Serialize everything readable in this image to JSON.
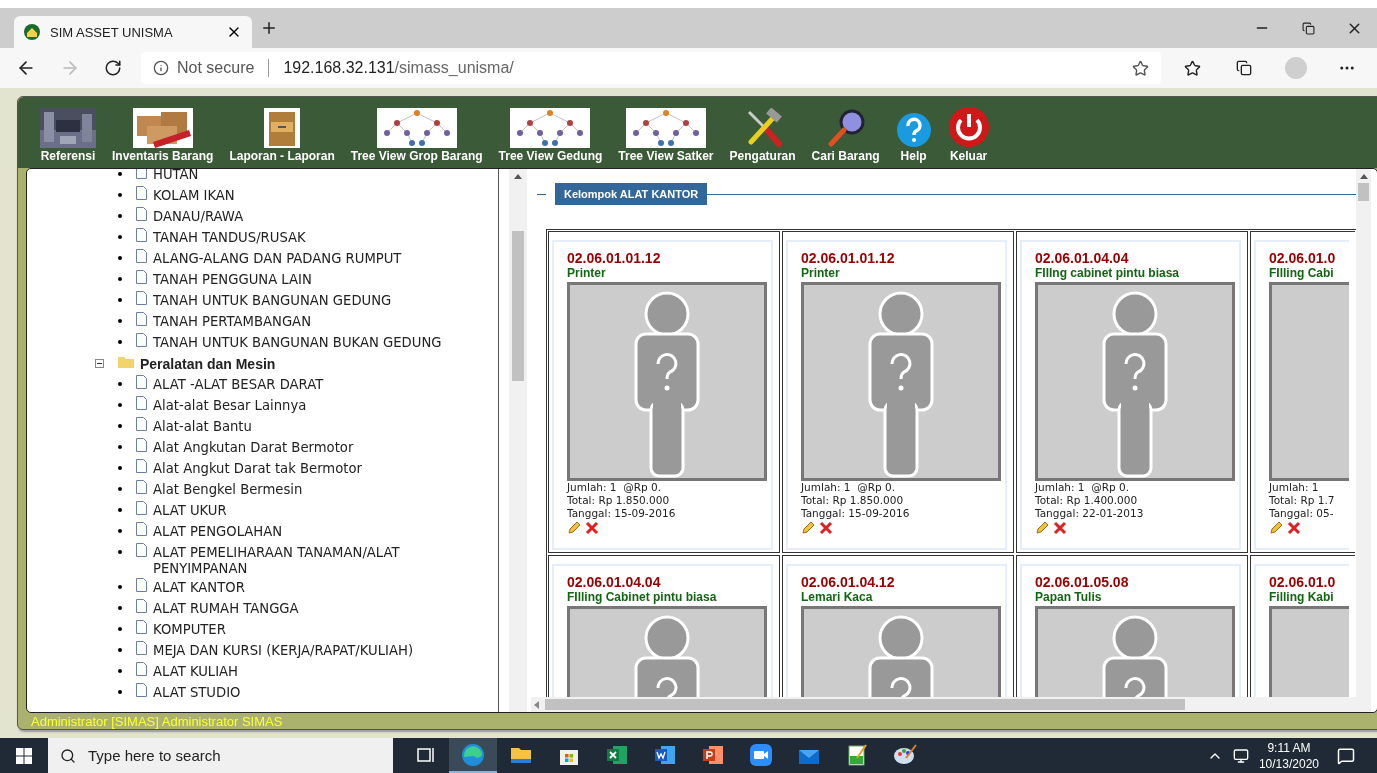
{
  "browser": {
    "tab_title": "SIM ASSET UNISMA",
    "security": "Not secure",
    "url": {
      "host": "192.168.32.131",
      "path": "/simass_unisma/"
    }
  },
  "toolbar": [
    {
      "label": "Referensi"
    },
    {
      "label": "Inventaris Barang",
      "kind": "boxes"
    },
    {
      "label": "Laporan - Laporan",
      "kind": "cabinet"
    },
    {
      "label": "Tree View Grop Barang",
      "kind": "tree"
    },
    {
      "label": "Tree View Gedung",
      "kind": "tree"
    },
    {
      "label": "Tree View Satker",
      "kind": "tree"
    },
    {
      "label": "Pengaturan",
      "kind": "tools"
    },
    {
      "label": "Cari Barang",
      "kind": "search"
    },
    {
      "label": "Help",
      "kind": "help"
    },
    {
      "label": "Keluar",
      "kind": "power"
    }
  ],
  "tree": [
    {
      "label": "HUTAN"
    },
    {
      "label": "KOLAM IKAN"
    },
    {
      "label": "DANAU/RAWA"
    },
    {
      "label": "TANAH TANDUS/RUSAK"
    },
    {
      "label": "ALANG-ALANG DAN PADANG RUMPUT"
    },
    {
      "label": "TANAH PENGGUNA LAIN"
    },
    {
      "label": "TANAH UNTUK BANGUNAN GEDUNG"
    },
    {
      "label": "TANAH PERTAMBANGAN"
    },
    {
      "label": "TANAH UNTUK BANGUNAN BUKAN GEDUNG"
    },
    {
      "label": "Peralatan dan Mesin",
      "expanded": true,
      "children": [
        {
          "label": "ALAT -ALAT BESAR DARAT"
        },
        {
          "label": "Alat-alat Besar Lainnya"
        },
        {
          "label": "Alat-alat Bantu"
        },
        {
          "label": "Alat Angkutan Darat Bermotor"
        },
        {
          "label": "Alat Angkut Darat tak Bermotor"
        },
        {
          "label": "Alat Bengkel Bermesin"
        },
        {
          "label": "ALAT UKUR"
        },
        {
          "label": "ALAT PENGOLAHAN"
        },
        {
          "label": "ALAT PEMELIHARAAN TANAMAN/ALAT PENYIMPANAN"
        },
        {
          "label": "ALAT KANTOR"
        },
        {
          "label": "ALAT RUMAH TANGGA"
        },
        {
          "label": "KOMPUTER"
        },
        {
          "label": "MEJA DAN KURSI (KERJA/RAPAT/KULIAH)"
        },
        {
          "label": "ALAT KULIAH"
        },
        {
          "label": "ALAT STUDIO"
        }
      ]
    }
  ],
  "panel": {
    "legend": "Kelompok ALAT KANTOR",
    "rows": [
      [
        {
          "code": "02.06.01.01.12",
          "name": "Printer",
          "lines": [
            "Jumlah: 1  @Rp 0.",
            "Total: Rp 1.850.000",
            "Tanggal: 15-09-2016"
          ]
        },
        {
          "code": "02.06.01.01.12",
          "name": "Printer",
          "lines": [
            "Jumlah: 1  @Rp 0.",
            "Total: Rp 1.850.000",
            "Tanggal: 15-09-2016"
          ]
        },
        {
          "code": "02.06.01.04.04",
          "name": "FIlIng cabinet pintu biasa",
          "lines": [
            "Jumlah: 1  @Rp 0.",
            "Total: Rp 1.400.000",
            "Tanggal: 22-01-2013"
          ]
        },
        {
          "code": "02.06.01.0",
          "name": "FIlling Cabi",
          "lines": [
            "Jumlah: 1",
            "Total: Rp 1.7",
            "Tanggal: 05-"
          ]
        }
      ],
      [
        {
          "code": "02.06.01.04.04",
          "name": "FIlling Cabinet pintu biasa"
        },
        {
          "code": "02.06.01.04.12",
          "name": "Lemari Kaca"
        },
        {
          "code": "02.06.01.05.08",
          "name": "Papan Tulis"
        },
        {
          "code": "02.06.01.0",
          "name": "Filling Kabi"
        }
      ]
    ]
  },
  "status_bar": "Administrator [SIMAS] Administrator SIMAS",
  "taskbar": {
    "search_placeholder": "Type here to search",
    "apps": [
      {
        "kind": "taskview",
        "selected": false
      },
      {
        "kind": "edge",
        "selected": true
      },
      {
        "kind": "explorer",
        "selected": false
      },
      {
        "kind": "store",
        "selected": false
      },
      {
        "kind": "excel",
        "selected": false
      },
      {
        "kind": "word",
        "selected": false
      },
      {
        "kind": "powerpoint",
        "selected": false
      },
      {
        "kind": "zoom",
        "selected": false
      },
      {
        "kind": "mail",
        "selected": false
      },
      {
        "kind": "notepad",
        "selected": false
      },
      {
        "kind": "paint",
        "selected": false
      }
    ],
    "time": "9:11 AM",
    "date": "10/13/2020"
  }
}
